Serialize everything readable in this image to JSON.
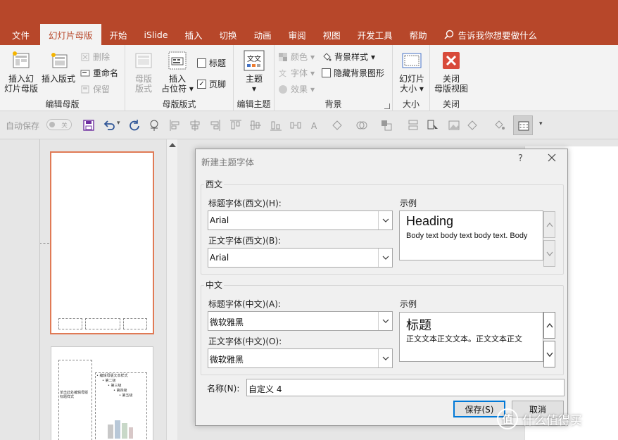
{
  "tabs": [
    {
      "label": "文件",
      "active": false
    },
    {
      "label": "幻灯片母版",
      "active": true
    },
    {
      "label": "开始",
      "active": false
    },
    {
      "label": "iSlide",
      "active": false
    },
    {
      "label": "插入",
      "active": false
    },
    {
      "label": "切换",
      "active": false
    },
    {
      "label": "动画",
      "active": false
    },
    {
      "label": "审阅",
      "active": false
    },
    {
      "label": "视图",
      "active": false
    },
    {
      "label": "开发工具",
      "active": false
    },
    {
      "label": "帮助",
      "active": false
    }
  ],
  "tell_me": "告诉我你想要做什么",
  "ribbon": {
    "edit_master": {
      "group": "编辑母版",
      "insert_master": "插入幻灯片母版",
      "insert_master_l1": "插入幻",
      "insert_master_l2": "灯片母版",
      "insert_layout": "插入版式",
      "delete": "删除",
      "rename": "重命名",
      "preserve": "保留"
    },
    "master_layout": {
      "group": "母版版式",
      "master_layout_l1": "母版",
      "master_layout_l2": "版式",
      "insert_placeholder_l1": "插入",
      "insert_placeholder_l2": "占位符",
      "title_cb": "标题",
      "title_checked": false,
      "footer_cb": "页脚",
      "footer_checked": true
    },
    "edit_theme": {
      "group": "编辑主题",
      "themes": "主题"
    },
    "background": {
      "group": "背景",
      "colors": "颜色",
      "fonts": "字体",
      "effects": "效果",
      "bg_styles": "背景样式",
      "hide_bg": "隐藏背景图形",
      "hide_bg_checked": false
    },
    "size": {
      "group": "大小",
      "slide_size_l1": "幻灯片",
      "slide_size_l2": "大小"
    },
    "close": {
      "group": "关闭",
      "close_l1": "关闭",
      "close_l2": "母版视图"
    }
  },
  "qat": {
    "autosave": "自动保存",
    "toggle": "关"
  },
  "thumbs": {
    "t2_title_ph": "单击此处编辑母版标题样式",
    "t2_text_l1": "• 编辑母版文本样式",
    "t2_text_l2": "• 第二级",
    "t2_text_l3": "• 第三级",
    "t2_text_l4": "• 第四级",
    "t2_text_l5": "• 第五级"
  },
  "dialog": {
    "title": "新建主题字体",
    "help": "?",
    "western": {
      "legend": "西文",
      "heading_label": "标题字体(西文)(H):",
      "heading_value": "Arial",
      "body_label": "正文字体(西文)(B):",
      "body_value": "Arial",
      "sample_label": "示例",
      "sample_heading": "Heading",
      "sample_body": "Body text body text body text. Body"
    },
    "asian": {
      "legend": "中文",
      "heading_label": "标题字体(中文)(A):",
      "heading_value": "微软雅黑",
      "body_label": "正文字体(中文)(O):",
      "body_value": "微软雅黑",
      "sample_label": "示例",
      "sample_heading": "标题",
      "sample_body": "正文文本正文文本。正文文本正文"
    },
    "name_label": "名称(N):",
    "name_value": "自定义 4",
    "save": "保存(S)",
    "cancel": "取消"
  },
  "watermark": "什么值得买",
  "watermark_logo": "值",
  "colors": {
    "accent": "#b7472a",
    "thumb_border": "#e07a55",
    "default_btn": "#0078d7"
  }
}
